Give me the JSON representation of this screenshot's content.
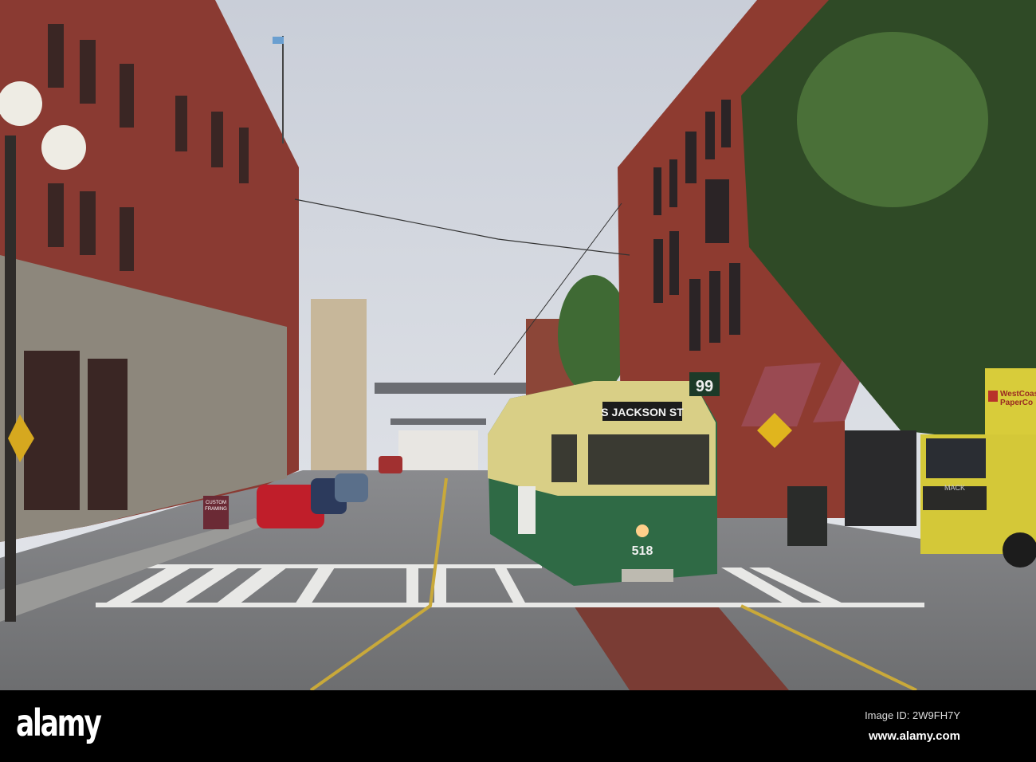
{
  "tram": {
    "destination": "S JACKSON ST",
    "route": "99",
    "fleet_number": "518"
  },
  "truck": {
    "brand": "MACK",
    "sign_line1": "WestCoast",
    "sign_line2": "PaperCo"
  },
  "sidewalk_sign": {
    "line1": "CUSTOM",
    "line2": "FRAMING"
  },
  "watermark": {
    "logo": "alamy",
    "image_id": "Image ID: 2W9FH7Y",
    "url": "www.alamy.com"
  },
  "colors": {
    "sky": "#d6dbe2",
    "brick": "#8a3a32",
    "tram_green": "#2f6a45",
    "tram_yellow": "#d9cf86",
    "road": "#7c7d80",
    "truck_yellow": "#d8cc3a"
  }
}
